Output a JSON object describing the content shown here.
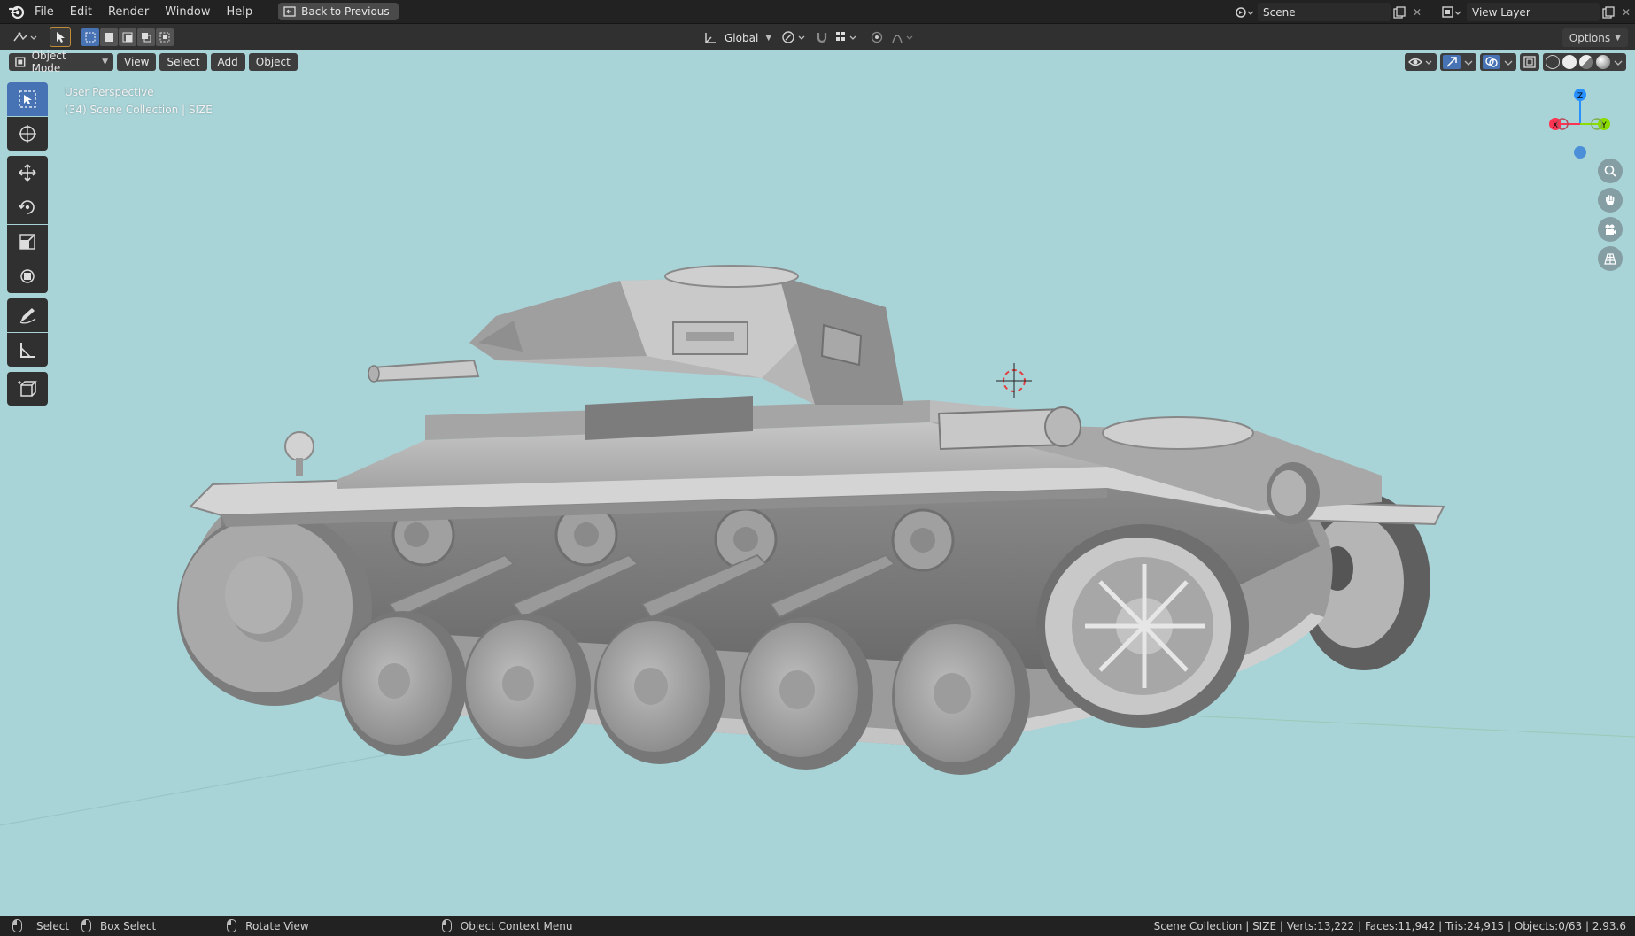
{
  "menu": {
    "items": [
      "File",
      "Edit",
      "Render",
      "Window",
      "Help"
    ],
    "back_label": "Back to Previous"
  },
  "top_right": {
    "scene_label": "Scene",
    "view_layer_label": "View Layer"
  },
  "tool_header": {
    "transform_orientation": "Global",
    "options_label": "Options"
  },
  "viewport_header": {
    "mode_label": "Object Mode",
    "menus": [
      "View",
      "Select",
      "Add",
      "Object"
    ]
  },
  "viewport_overlay": {
    "perspective": "User Perspective",
    "collection_info": "(34) Scene Collection | SIZE"
  },
  "gizmo": {
    "x_label": "X",
    "y_label": "Y",
    "z_label": "Z",
    "x_color": "#ff3352",
    "y_color": "#8bdc00",
    "z_color": "#2890ff"
  },
  "toolbar": {
    "tools": [
      "select-box-tool",
      "cursor-tool",
      "move-tool",
      "rotate-tool",
      "scale-tool",
      "transform-tool",
      "annotate-tool",
      "measure-tool",
      "add-cube-tool"
    ]
  },
  "status": {
    "select_label": "Select",
    "box_select_label": "Box Select",
    "rotate_label": "Rotate View",
    "context_label": "Object Context Menu",
    "stats": "Scene Collection | SIZE | Verts:13,222 | Faces:11,942 | Tris:24,915 | Objects:0/63 | 2.93.6"
  },
  "colors": {
    "viewport_bg": "#a8d4d8",
    "accent": "#4772b3"
  }
}
